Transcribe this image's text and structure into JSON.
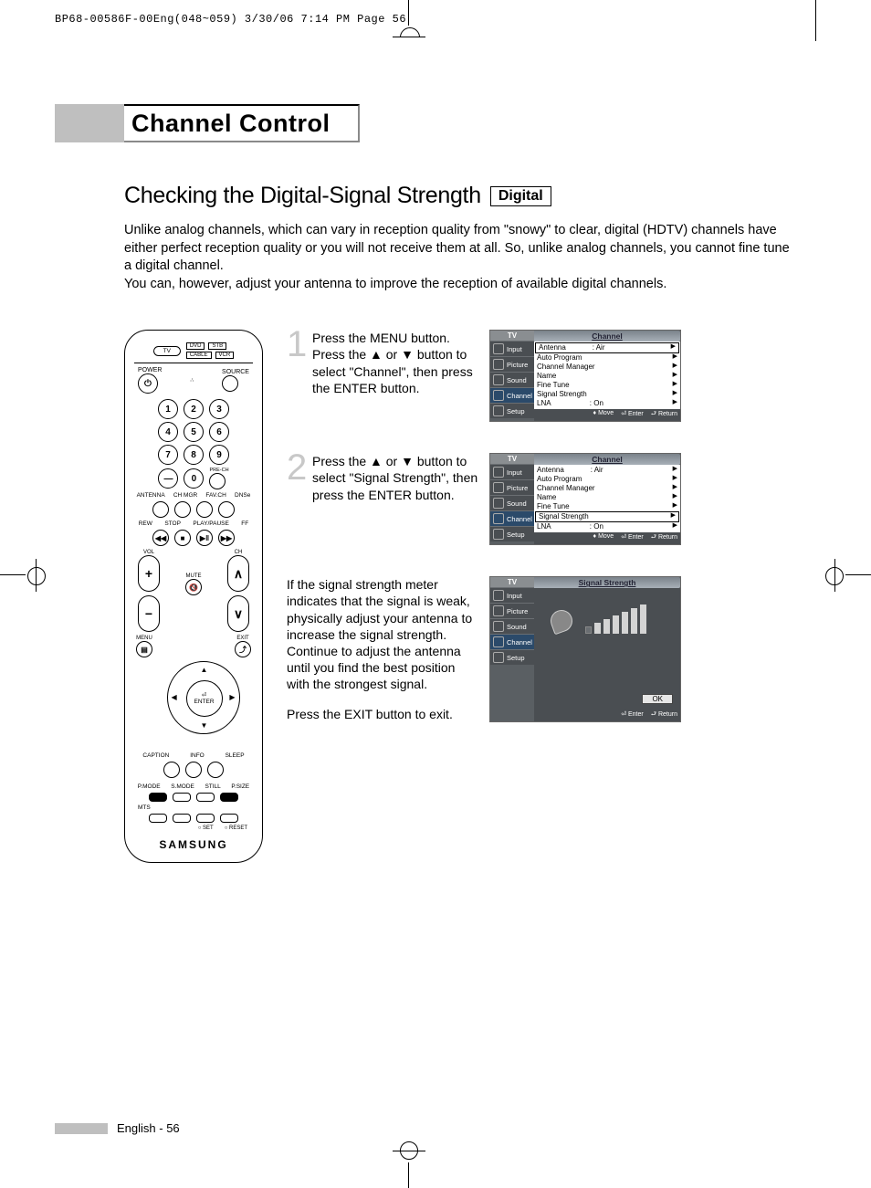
{
  "meta": {
    "header_line": "BP68-00586F-00Eng(048~059)  3/30/06  7:14 PM  Page 56"
  },
  "section_title": "Channel Control",
  "subheading": "Checking the Digital-Signal Strength",
  "digital_badge": "Digital",
  "intro_p1": "Unlike analog channels, which can vary in reception quality from \"snowy\" to clear, digital (HDTV) channels have either perfect reception quality or you will not receive them at all. So, unlike analog channels, you cannot fine tune a digital channel.",
  "intro_p2": "You can, however, adjust your antenna to improve the reception of available digital channels.",
  "steps": {
    "s1": {
      "num": "1",
      "text": "Press the MENU button. Press the ▲ or ▼ button to select \"Channel\", then press the ENTER button."
    },
    "s2": {
      "num": "2",
      "text": "Press the ▲ or ▼ button to select \"Signal Strength\", then press the ENTER button."
    },
    "s3a": "If the signal strength meter indicates that the signal is weak, physically adjust your antenna to increase the signal strength. Continue to adjust the antenna until you find the best position with the strongest signal.",
    "s3b": "Press the EXIT button to exit."
  },
  "osd": {
    "tv_label": "TV",
    "sidebar": {
      "input": "Input",
      "picture": "Picture",
      "sound": "Sound",
      "channel": "Channel",
      "setup": "Setup"
    },
    "channel_title": "Channel",
    "signal_title": "Signal Strength",
    "items": {
      "antenna": "Antenna",
      "antenna_val": ": Air",
      "auto_program": "Auto Program",
      "channel_manager": "Channel Manager",
      "name": "Name",
      "fine_tune": "Fine Tune",
      "signal_strength": "Signal Strength",
      "lna": "LNA",
      "lna_val": ": On"
    },
    "footer": {
      "move": "Move",
      "enter": "Enter",
      "return": "Return"
    },
    "ok": "OK"
  },
  "remote": {
    "tv": "TV",
    "dvd": "DVD",
    "stb": "STB",
    "cable": "CABLE",
    "vcr": "VCR",
    "power": "POWER",
    "source": "SOURCE",
    "n1": "1",
    "n2": "2",
    "n3": "3",
    "n4": "4",
    "n5": "5",
    "n6": "6",
    "n7": "7",
    "n8": "8",
    "n9": "9",
    "dash": "—",
    "n0": "0",
    "pre_ch": "PRE-CH",
    "antenna": "ANTENNA",
    "chmgr": "CH MGR",
    "favch": "FAV.CH",
    "dnse": "DNSe",
    "rew": "REW",
    "stop": "STOP",
    "playpause": "PLAY/PAUSE",
    "ff": "FF",
    "vol": "VOL",
    "ch": "CH",
    "mute": "MUTE",
    "menu": "MENU",
    "exit": "EXIT",
    "enter": "ENTER",
    "enter_icon": "⏎",
    "caption": "CAPTION",
    "info": "INFO",
    "sleep": "SLEEP",
    "pmode": "P.MODE",
    "smode": "S.MODE",
    "still": "STILL",
    "psize": "P.SIZE",
    "mts": "MTS",
    "set": "SET",
    "reset": "RESET",
    "brand": "SAMSUNG"
  },
  "footer": "English - 56"
}
